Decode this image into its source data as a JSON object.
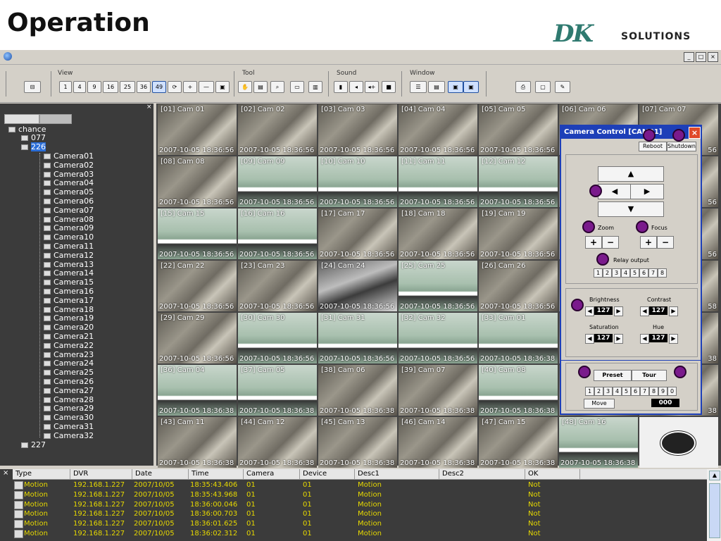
{
  "slide": {
    "title": "Operation",
    "brand_mark": "DK",
    "brand_name": "SOLUTIONS"
  },
  "window": {
    "controls": [
      "_",
      "□",
      "×"
    ]
  },
  "toolbar": {
    "view_label": "View",
    "view_buttons": [
      "1",
      "4",
      "9",
      "16",
      "25",
      "36",
      "49",
      "⟳",
      "+",
      "—",
      "▣"
    ],
    "view_selected": "49",
    "tool_label": "Tool",
    "sound_label": "Sound",
    "window_label": "Window"
  },
  "tree": {
    "root": "chance",
    "groups": [
      {
        "name": "077",
        "expanded": false
      },
      {
        "name": "226",
        "expanded": true
      },
      {
        "name": "227",
        "expanded": false
      }
    ],
    "cameras": [
      "Camera01",
      "Camera02",
      "Camera03",
      "Camera04",
      "Camera05",
      "Camera06",
      "Camera07",
      "Camera08",
      "Camera09",
      "Camera10",
      "Camera11",
      "Camera12",
      "Camera13",
      "Camera14",
      "Camera15",
      "Camera16",
      "Camera17",
      "Camera18",
      "Camera19",
      "Camera20",
      "Camera21",
      "Camera22",
      "Camera23",
      "Camera24",
      "Camera25",
      "Camera26",
      "Camera27",
      "Camera28",
      "Camera29",
      "Camera30",
      "Camera31",
      "Camera32"
    ]
  },
  "grid": {
    "cells": [
      {
        "label": "[01] Cam 01",
        "ts": "2007-10-05 18:36:56",
        "bg": "dark"
      },
      {
        "label": "[02] Cam 02",
        "ts": "2007-10-05 18:36:56",
        "bg": "dark"
      },
      {
        "label": "[03] Cam 03",
        "ts": "2007-10-05 18:36:56",
        "bg": "dark"
      },
      {
        "label": "[04] Cam 04",
        "ts": "2007-10-05 18:36:56",
        "bg": "dark"
      },
      {
        "label": "[05] Cam 05",
        "ts": "2007-10-05 18:36:56",
        "bg": "dark"
      },
      {
        "label": "[06] Cam 06",
        "ts": "56",
        "bg": "dark"
      },
      {
        "label": "[07] Cam 07",
        "ts": "56",
        "bg": "dark"
      },
      {
        "label": "[08] Cam 08",
        "ts": "2007-10-05 18:36:56",
        "bg": "dark"
      },
      {
        "label": "[09] Cam 09",
        "ts": "2007-10-05 18:36:56",
        "bg": "green"
      },
      {
        "label": "[10] Cam 10",
        "ts": "2007-10-05 18:36:56",
        "bg": "green"
      },
      {
        "label": "[11] Cam 11",
        "ts": "2007-10-05 18:36:56",
        "bg": "green"
      },
      {
        "label": "[12] Cam 12",
        "ts": "2007-10-05 18:36:56",
        "bg": "green"
      },
      {
        "label": "",
        "ts": "",
        "bg": "dark"
      },
      {
        "label": "",
        "ts": "56",
        "bg": "dark"
      },
      {
        "label": "[15] Cam 15",
        "ts": "2007-10-05 18:36:56",
        "bg": "green"
      },
      {
        "label": "[16] Cam 16",
        "ts": "2007-10-05 18:36:56",
        "bg": "green"
      },
      {
        "label": "[17] Cam 17",
        "ts": "2007-10-05 18:36:56",
        "bg": "dark"
      },
      {
        "label": "[18] Cam 18",
        "ts": "2007-10-05 18:36:56",
        "bg": "dark"
      },
      {
        "label": "[19] Cam 19",
        "ts": "2007-10-05 18:36:56",
        "bg": "dark"
      },
      {
        "label": "",
        "ts": "",
        "bg": "dark"
      },
      {
        "label": "",
        "ts": "56",
        "bg": "dark"
      },
      {
        "label": "[22] Cam 22",
        "ts": "2007-10-05 18:36:56",
        "bg": "dark"
      },
      {
        "label": "[23] Cam 23",
        "ts": "2007-10-05 18:36:56",
        "bg": "dark"
      },
      {
        "label": "[24] Cam 24",
        "ts": "2007-10-05 18:36:56",
        "bg": "crowd"
      },
      {
        "label": "[25] Cam 25",
        "ts": "2007-10-05 18:36:56",
        "bg": "green"
      },
      {
        "label": "[26] Cam 26",
        "ts": "2007-10-05 18:36:56",
        "bg": "dark"
      },
      {
        "label": "",
        "ts": "",
        "bg": "dark"
      },
      {
        "label": "",
        "ts": "58",
        "bg": "dark"
      },
      {
        "label": "[29] Cam 29",
        "ts": "2007-10-05 18:36:56",
        "bg": "dark"
      },
      {
        "label": "[30] Cam 30",
        "ts": "2007-10-05 18:36:56",
        "bg": "green"
      },
      {
        "label": "[31] Cam 31",
        "ts": "2007-10-05 18:36:56",
        "bg": "green"
      },
      {
        "label": "[32] Cam 32",
        "ts": "2007-10-05 18:36:56",
        "bg": "green"
      },
      {
        "label": "[33] Cam 01",
        "ts": "2007-10-05 18:36:38",
        "bg": "green"
      },
      {
        "label": "",
        "ts": "",
        "bg": "dark"
      },
      {
        "label": "",
        "ts": "38",
        "bg": "dark"
      },
      {
        "label": "[36] Cam 04",
        "ts": "2007-10-05 18:36:38",
        "bg": "green"
      },
      {
        "label": "[37] Cam 05",
        "ts": "2007-10-05 18:36:38",
        "bg": "green"
      },
      {
        "label": "[38] Cam 06",
        "ts": "2007-10-05 18:36:38",
        "bg": "dark"
      },
      {
        "label": "[39] Cam 07",
        "ts": "2007-10-05 18:36:38",
        "bg": "dark"
      },
      {
        "label": "[40] Cam 08",
        "ts": "2007-10-05 18:36:38",
        "bg": "green"
      },
      {
        "label": "",
        "ts": "",
        "bg": "dark"
      },
      {
        "label": "",
        "ts": "38",
        "bg": "dark"
      },
      {
        "label": "[43] Cam 11",
        "ts": "2007-10-05 18:36:38",
        "bg": "dark"
      },
      {
        "label": "[44] Cam 12",
        "ts": "2007-10-05 18:36:38",
        "bg": "dark"
      },
      {
        "label": "[45] Cam 13",
        "ts": "2007-10-05 18:36:38",
        "bg": "dark"
      },
      {
        "label": "[46] Cam 14",
        "ts": "2007-10-05 18:36:38",
        "bg": "dark"
      },
      {
        "label": "[47] Cam 15",
        "ts": "2007-10-05 18:36:38",
        "bg": "dark"
      },
      {
        "label": "[48] Cam 16",
        "ts": "2007-10-05 18:36:38",
        "bg": "green"
      },
      {
        "label": "",
        "ts": "",
        "bg": "white"
      }
    ]
  },
  "camera_control": {
    "title": "Camera Control [CAM01]",
    "reboot": "Reboot",
    "shutdown": "Shutdown",
    "zoom": "Zoom",
    "focus": "Focus",
    "relay_output": "Relay output",
    "relays": [
      "1",
      "2",
      "3",
      "4",
      "5",
      "6",
      "7",
      "8"
    ],
    "brightness": "Brightness",
    "contrast": "Contrast",
    "saturation": "Saturation",
    "hue": "Hue",
    "brightness_value": "127",
    "contrast_value": "127",
    "saturation_value": "127",
    "hue_value": "127",
    "preset": "Preset",
    "tour": "Tour",
    "preset_numbers": [
      "1",
      "2",
      "3",
      "4",
      "5",
      "6",
      "7",
      "8",
      "9",
      "0"
    ],
    "move": "Move",
    "preset_value": "000"
  },
  "log": {
    "columns": [
      "Type",
      "DVR",
      "Date",
      "Time",
      "Camera",
      "Device",
      "Desc1",
      "Desc2",
      "OK"
    ],
    "rows": [
      [
        "Motion",
        "192.168.1.227",
        "2007/10/05",
        "18:35:43.406",
        "01",
        "01",
        "Motion",
        "",
        "Not"
      ],
      [
        "Motion",
        "192.168.1.227",
        "2007/10/05",
        "18:35:43.968",
        "01",
        "01",
        "Motion",
        "",
        "Not"
      ],
      [
        "Motion",
        "192.168.1.227",
        "2007/10/05",
        "18:36:00.046",
        "01",
        "01",
        "Motion",
        "",
        "Not"
      ],
      [
        "Motion",
        "192.168.1.227",
        "2007/10/05",
        "18:36:00.703",
        "01",
        "01",
        "Motion",
        "",
        "Not"
      ],
      [
        "Motion",
        "192.168.1.227",
        "2007/10/05",
        "18:36:01.625",
        "01",
        "01",
        "Motion",
        "",
        "Not"
      ],
      [
        "Motion",
        "192.168.1.227",
        "2007/10/05",
        "18:36:02.312",
        "01",
        "01",
        "Motion",
        "",
        "Not"
      ]
    ]
  },
  "colors": {
    "window_bg": "#d4d0c8",
    "panel_dark": "#3b3b3b",
    "dialog_border": "#1d3fb8",
    "log_text": "#e6d800",
    "marker": "#7a1a8c"
  }
}
